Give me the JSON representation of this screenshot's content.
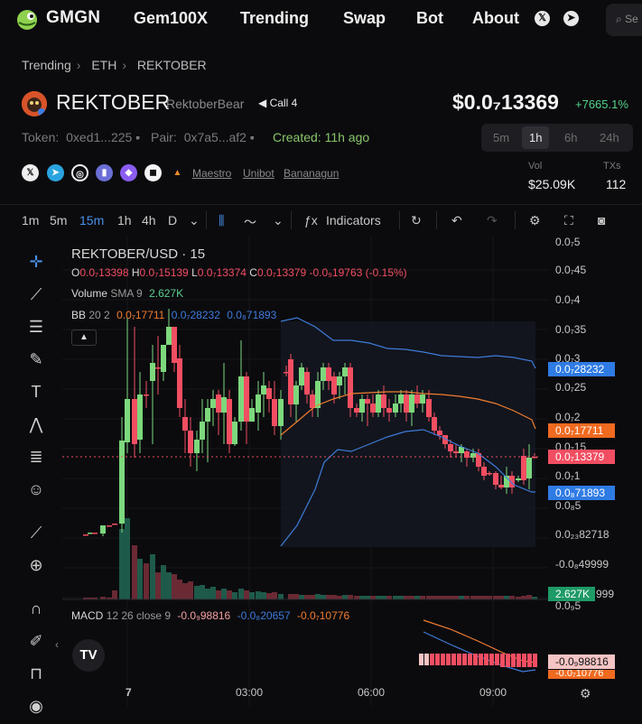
{
  "nav": {
    "brand": "GMGN",
    "links": [
      "Gem100X",
      "Trending",
      "Swap",
      "Bot",
      "About"
    ],
    "search_placeholder": "Se"
  },
  "breadcrumb": [
    "Trending",
    "ETH",
    "REKTOBER"
  ],
  "token": {
    "name": "REKTOBER",
    "handle": "RektoberBear",
    "call": "Call 4",
    "price": "$0.0₇13369",
    "change": "+7665.1%",
    "token_label": "Token:",
    "token_addr": "0xed1...225",
    "pair_label": "Pair:",
    "pair_addr": "0x7a5...af2",
    "created": "Created:  11h ago"
  },
  "timeframes": [
    "5m",
    "1h",
    "6h",
    "24h"
  ],
  "active_timeframe": "1h",
  "platform_links": [
    "Maestro",
    "Unibot",
    "Bananagun"
  ],
  "stats": {
    "vol_label": "Vol",
    "vol_value": "$25.09K",
    "txs_label": "TXs",
    "txs_value": "112"
  },
  "toolbar": {
    "intervals": [
      "1m",
      "5m",
      "15m",
      "1h",
      "4h",
      "D"
    ],
    "active_interval": "15m",
    "indicators_label": "Indicators"
  },
  "chart_overlay": {
    "symbol": "REKTOBER/USD · 15",
    "ohlc": {
      "o": "0.0₇13398",
      "h": "0.0₇15139",
      "l": "0.0₇13374",
      "c": "0.0₇13379",
      "chg": "-0.0₉19763 (-0.15%)"
    },
    "volume": {
      "label": "Volume",
      "sma": "SMA 9",
      "value": "2.627K"
    },
    "bb": {
      "label": "BB",
      "params": "20 2",
      "mid": "0.0₇17711",
      "upper": "0.0₇28232",
      "lower": "0.0₈71893"
    },
    "macd": {
      "label": "MACD",
      "params": "12 26 close 9",
      "v1": "-0.0₉98816",
      "v2": "-0.0₈20657",
      "v3": "-0.0₇10776"
    }
  },
  "price_axis": [
    "0.0₇5",
    "0.0₇45",
    "0.0₇4",
    "0.0₇35",
    "0.0₇3",
    "0.0₇25",
    "0.0₇2",
    "0.0₇15",
    "0.0₇1",
    "0.0₈5",
    "0.0₂₃82718",
    "-0.0₈49999",
    "999",
    "0.0₉5"
  ],
  "price_badges": {
    "upper": "0.0₇28232",
    "mid": "0.0₇17711",
    "last": "0.0₇13379",
    "lower": "0.0₈71893",
    "volume": "2.627K",
    "macd1": "-0.0₉98816",
    "macd2": "-0.0₇10776"
  },
  "time_axis": [
    "7",
    "03:00",
    "06:00",
    "09:00"
  ],
  "colors": {
    "up": "#7dd87d",
    "down": "#f24e62",
    "bb_upper": "#3e7bd9",
    "bb_mid": "#f07d30",
    "badge_blue": "#2f7be4",
    "badge_orange": "#f06a20",
    "badge_red": "#f24e62",
    "badge_green": "#1e9a66"
  }
}
